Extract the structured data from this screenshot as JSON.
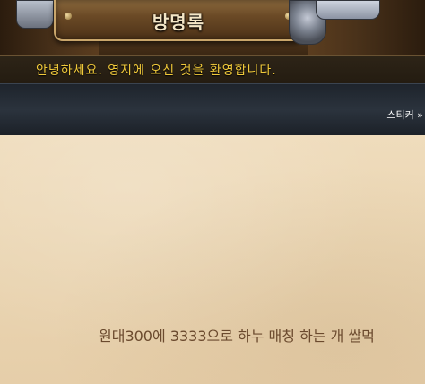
{
  "banner": {
    "title": "방명록"
  },
  "greeting": {
    "text": "안녕하세요. 영지에 오신 것을 환영합니다."
  },
  "toolbar": {
    "sticker_tab_label": "스티커 »"
  },
  "post": {
    "text": "원대300에 3333으로 하누 매칭  하는 개 쌀먹"
  },
  "colors": {
    "greeting": "#f0c93a",
    "post_text": "#6b4a2e",
    "parchment": "#ead5b2"
  }
}
